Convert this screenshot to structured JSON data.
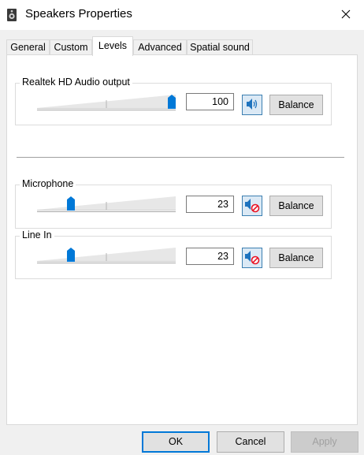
{
  "window": {
    "title": "Speakers Properties"
  },
  "tabs": [
    {
      "label": "General"
    },
    {
      "label": "Custom"
    },
    {
      "label": "Levels",
      "active": true
    },
    {
      "label": "Advanced"
    },
    {
      "label": "Spatial sound"
    }
  ],
  "levels": [
    {
      "label": "Realtek HD Audio output",
      "value": "100",
      "level_fraction": 1.0,
      "muted": false,
      "balance_label": "Balance"
    },
    {
      "label": "Microphone",
      "value": "23",
      "level_fraction": 0.23,
      "muted": true,
      "balance_label": "Balance"
    },
    {
      "label": "Line In",
      "value": "23",
      "level_fraction": 0.23,
      "muted": true,
      "balance_label": "Balance"
    }
  ],
  "footer": {
    "ok_label": "OK",
    "cancel_label": "Cancel",
    "apply_label": "Apply"
  },
  "colors": {
    "accent": "#0078d7",
    "mute_button_bg": "#dbe9f5",
    "muted_sign": "#e81123"
  },
  "icons": {
    "window": "speaker-device-icon",
    "close": "close-icon",
    "speaker": "speaker-icon",
    "speaker_muted": "speaker-muted-icon"
  }
}
